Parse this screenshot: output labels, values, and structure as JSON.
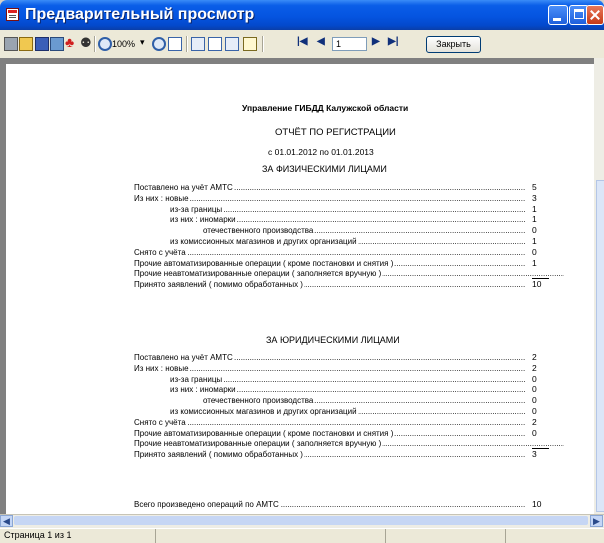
{
  "window": {
    "title": "Предварительный просмотр"
  },
  "toolbar": {
    "zoom": "100%",
    "page": "1",
    "close_label": "Закрыть"
  },
  "report": {
    "header": "Управление ГИБДД Калужской области",
    "title": "ОТЧЁТ ПО РЕГИСТРАЦИИ",
    "period": "с 01.01.2012 по 01.01.2013",
    "sections": [
      {
        "heading": "ЗА ФИЗИЧЕСКИМИ ЛИЦАМИ",
        "rows": [
          {
            "label": "Поставлено на учёт АМТС",
            "value": "5"
          },
          {
            "label": "Из них : новые",
            "value": "3"
          },
          {
            "label": "из-за границы",
            "value": "1"
          },
          {
            "label": "из них : иномарки",
            "value": "1"
          },
          {
            "label": "отечественного производства",
            "value": "0"
          },
          {
            "label": "из комиссионных магазинов и других организаций",
            "value": "1"
          },
          {
            "label": "Снято с учёта",
            "value": "0"
          },
          {
            "label": "Прочие автоматизированные операции ( кроме постановки и снятия )",
            "value": "1"
          },
          {
            "label": "Прочие неавтоматизированные операции ( заполняется вручную )",
            "value": ""
          },
          {
            "label": "Принято заявлений ( помимо обработанных )",
            "value": "10"
          }
        ]
      },
      {
        "heading": "ЗА ЮРИДИЧЕСКИМИ ЛИЦАМИ",
        "rows": [
          {
            "label": "Поставлено на учёт АМТС",
            "value": "2"
          },
          {
            "label": "Из них : новые",
            "value": "2"
          },
          {
            "label": "из-за границы",
            "value": "0"
          },
          {
            "label": "из них : иномарки",
            "value": "0"
          },
          {
            "label": "отечественного производства",
            "value": "0"
          },
          {
            "label": "из комиссионных магазинов и других организаций",
            "value": "0"
          },
          {
            "label": "Снято с учёта",
            "value": "2"
          },
          {
            "label": "Прочие автоматизированные операции ( кроме постановки и снятия )",
            "value": "0"
          },
          {
            "label": "Прочие неавтоматизированные операции ( заполняется вручную )",
            "value": ""
          },
          {
            "label": "Принято заявлений ( помимо обработанных )",
            "value": "3"
          }
        ]
      }
    ],
    "total": {
      "label": "Всего произведено операций по АМТС",
      "value": "10"
    }
  },
  "status": {
    "page_info": "Страница 1 из 1"
  }
}
